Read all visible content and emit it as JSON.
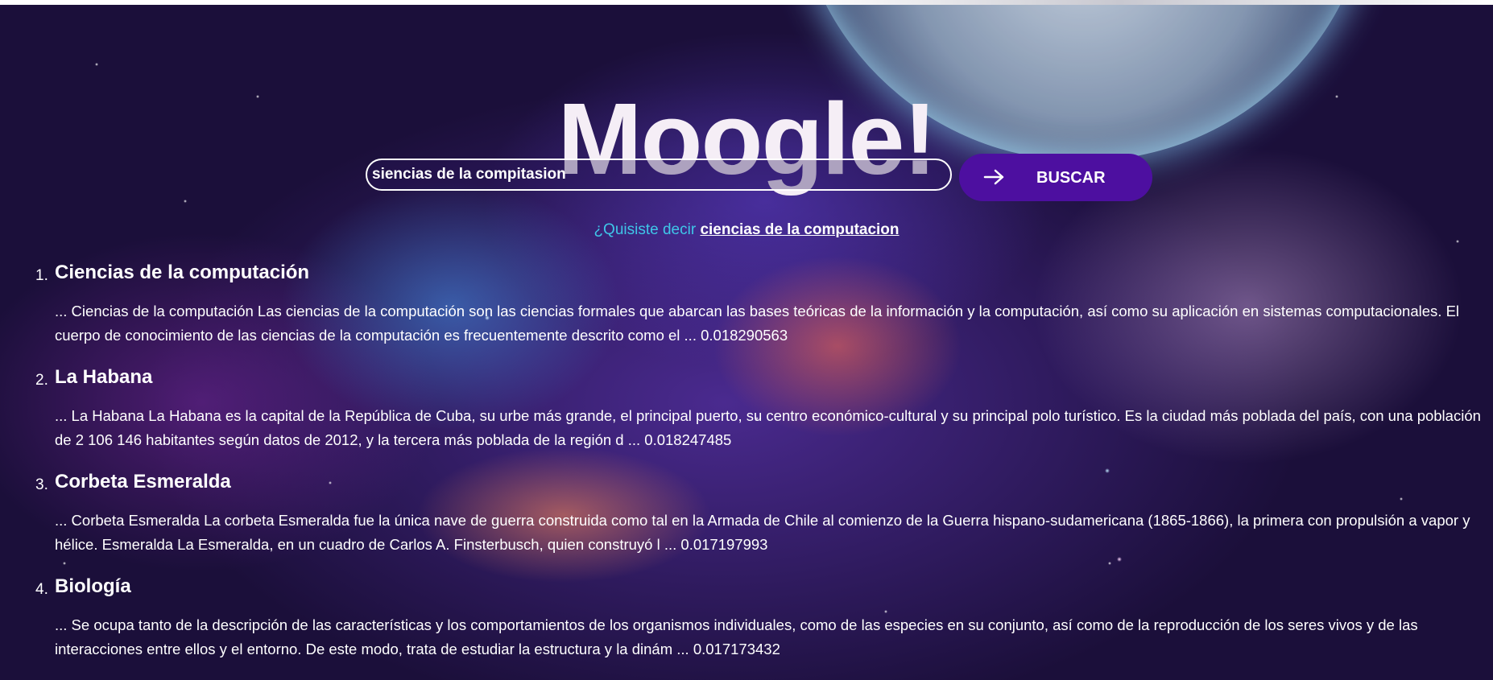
{
  "logo": "Moogle!",
  "search": {
    "query": "siencias de la compitasion",
    "button_label": "BUSCAR"
  },
  "suggestion": {
    "prompt": "¿Quisiste decir",
    "link": "ciencias de la computacion"
  },
  "results": [
    {
      "number": "1.",
      "title": "Ciencias de la computación",
      "snippet": "... Ciencias de la computación  Las ciencias de la computación son las ciencias formales que abarcan las bases teóricas de la información y la computación, así como su aplicación en sistemas computacionales. El cuerpo de conocimiento de las ciencias de la computación es frecuentemente descrito como el ... 0.018290563"
    },
    {
      "number": "2.",
      "title": "La Habana",
      "snippet": "... La Habana  La Habana es la capital de la República de Cuba, su urbe más grande, el principal puerto, su centro económico-cultural y su principal polo turístico. Es la ciudad más poblada del país, con una población de 2 106 146 habitantes según datos de 2012, y la tercera más poblada de la región d ... 0.018247485"
    },
    {
      "number": "3.",
      "title": "Corbeta Esmeralda",
      "snippet": "... Corbeta Esmeralda  La corbeta Esmeralda fue la única nave de guerra construida como tal en la Armada de Chile al comienzo de la Guerra hispano-sudamericana (1865-1866), la primera con propulsión a vapor y hélice. Esmeralda  La Esmeralda, en un cuadro de Carlos A. Finsterbusch, quien construyó l ... 0.017197993"
    },
    {
      "number": "4.",
      "title": "Biología",
      "snippet": "... Se ocupa tanto de la descripción de las características y los comportamientos de los organismos individuales, como de las especies en su conjunto, así como de la reproducción de los seres vivos y de las interacciones entre ellos y el entorno. De este modo, trata de estudiar la estructura y la dinám ... 0.017173432"
    }
  ],
  "colors": {
    "button_bg": "#4d0fa0",
    "suggestion_prompt": "#3fc6e8",
    "text": "#ffffff"
  },
  "icons": {
    "search_button_icon": "arrow-right-icon"
  }
}
